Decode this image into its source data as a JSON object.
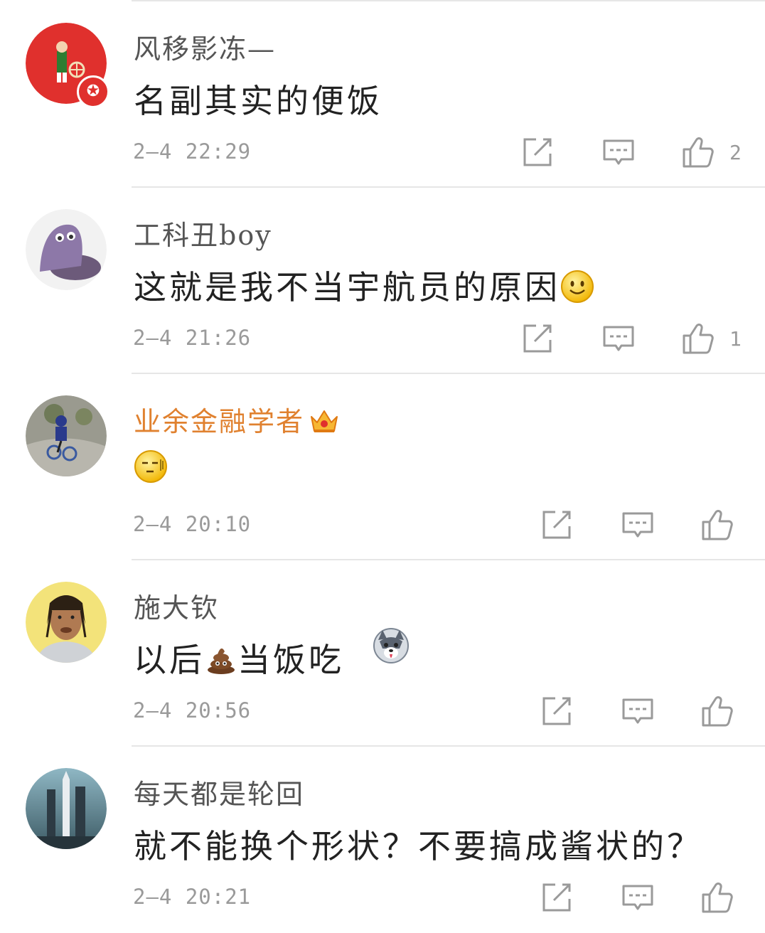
{
  "comments": [
    {
      "username": "风移影冻—",
      "text": "名副其实的便饭",
      "time": "2—4 22:29",
      "likes": "2",
      "avatar": "red-circle-illustration",
      "badge": "star-badge",
      "colors": {
        "avatar_bg": "#e0302d"
      }
    },
    {
      "username": "工科丑boy",
      "text": "这就是我不当宇航员的原因",
      "emoji": "smile-emoji",
      "time": "2—4 21:26",
      "likes": "1",
      "avatar": "purple-cartoon-creature"
    },
    {
      "username": "业余金融学者",
      "vip_icon": "crown-icon",
      "emoji": "speechless-emoji",
      "time": "2—4 20:10",
      "likes": "",
      "avatar": "child-on-bicycle-photo",
      "colors": {
        "username": "#e0812f"
      }
    },
    {
      "username": "施大钦",
      "text_before": "以后",
      "text_after": "当饭吃",
      "emoji_inline": "poop-emoji",
      "emoji_trailing": "husky-emoji",
      "time": "2—4 20:56",
      "likes": "",
      "avatar": "cartoon-man-portrait"
    },
    {
      "username": "每天都是轮回",
      "text": "就不能换个形状？不要搞成酱状的？",
      "time": "2—4 20:21",
      "likes": "",
      "avatar": "rocket-launch-photo"
    }
  ],
  "icons": {
    "repost": "edit-square-icon",
    "comment": "comment-bubble-icon",
    "like": "thumbs-up-icon"
  },
  "colors": {
    "meta_gray": "#9a9a9a",
    "divider": "#e6e6e6",
    "vip_orange": "#e0812f"
  }
}
